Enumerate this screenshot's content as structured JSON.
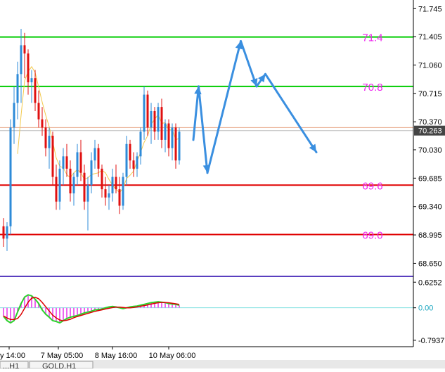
{
  "chart_data": {
    "type": "candlestick",
    "symbol_tabs": [
      "...H1",
      "GOLD,H1"
    ],
    "price_axis": {
      "ticks": [
        "71.745",
        "71.405",
        "71.060",
        "70.715",
        "70.370",
        "70.030",
        "69.685",
        "69.340",
        "68.995",
        "68.650"
      ],
      "ylim": [
        68.5,
        71.85
      ],
      "current_price": "70.263"
    },
    "time_axis": {
      "labels": [
        "y 14:00",
        "7 May 05:00",
        "8 May 16:00",
        "10 May 06:00"
      ]
    },
    "levels": [
      {
        "label": "71.4",
        "price": 71.4,
        "line_color": "#00cc00",
        "label_color": "#ee22ee"
      },
      {
        "label": "70.8",
        "price": 70.8,
        "line_color": "#00cc00",
        "label_color": "#ee22ee"
      },
      {
        "label": "69.6",
        "price": 69.6,
        "line_color": "#e00000",
        "label_color": "#ee22ee"
      },
      {
        "label": "69.0",
        "price": 69.0,
        "line_color": "#e00000",
        "label_color": "#ee22ee"
      }
    ],
    "bid_line": {
      "price": 70.3,
      "color": "#e8a888"
    },
    "ask_line": {
      "price": 70.263,
      "color": "#bbbbbb"
    },
    "candles": [
      [
        69.1,
        69.2,
        68.85,
        68.95
      ],
      [
        68.95,
        69.15,
        68.8,
        69.1
      ],
      [
        69.1,
        70.4,
        69.0,
        70.3
      ],
      [
        70.3,
        70.8,
        70.1,
        70.6
      ],
      [
        70.6,
        71.1,
        70.4,
        70.95
      ],
      [
        70.95,
        71.5,
        70.6,
        71.3
      ],
      [
        71.3,
        71.45,
        70.9,
        71.2
      ],
      [
        71.2,
        71.25,
        70.7,
        70.85
      ],
      [
        70.85,
        71.0,
        70.6,
        70.9
      ],
      [
        70.9,
        71.0,
        70.5,
        70.6
      ],
      [
        70.6,
        70.75,
        70.3,
        70.4
      ],
      [
        70.4,
        70.55,
        70.2,
        70.3
      ],
      [
        70.3,
        70.4,
        69.95,
        70.05
      ],
      [
        70.05,
        70.3,
        69.8,
        70.2
      ],
      [
        70.2,
        70.25,
        69.6,
        69.7
      ],
      [
        69.7,
        69.85,
        69.3,
        69.4
      ],
      [
        69.4,
        69.9,
        69.3,
        69.8
      ],
      [
        69.8,
        70.05,
        69.6,
        69.95
      ],
      [
        69.95,
        70.1,
        69.7,
        69.8
      ],
      [
        69.8,
        69.9,
        69.4,
        69.5
      ],
      [
        69.5,
        69.75,
        69.35,
        69.7
      ],
      [
        69.7,
        70.1,
        69.6,
        70.0
      ],
      [
        70.0,
        70.15,
        69.65,
        69.75
      ],
      [
        69.75,
        69.85,
        69.3,
        69.4
      ],
      [
        69.4,
        69.7,
        69.05,
        69.6
      ],
      [
        69.6,
        70.0,
        69.5,
        69.9
      ],
      [
        69.9,
        70.15,
        69.8,
        70.05
      ],
      [
        70.05,
        70.1,
        69.7,
        69.8
      ],
      [
        69.8,
        69.85,
        69.45,
        69.55
      ],
      [
        69.55,
        69.7,
        69.35,
        69.45
      ],
      [
        69.45,
        69.6,
        69.3,
        69.5
      ],
      [
        69.5,
        69.8,
        69.4,
        69.7
      ],
      [
        69.7,
        69.85,
        69.5,
        69.55
      ],
      [
        69.55,
        69.7,
        69.25,
        69.35
      ],
      [
        69.35,
        69.75,
        69.3,
        69.7
      ],
      [
        69.7,
        70.2,
        69.6,
        70.1
      ],
      [
        70.1,
        70.15,
        69.8,
        69.9
      ],
      [
        69.9,
        70.0,
        69.7,
        69.8
      ],
      [
        69.8,
        70.0,
        69.7,
        69.95
      ],
      [
        69.95,
        70.3,
        69.85,
        70.25
      ],
      [
        70.25,
        70.8,
        70.15,
        70.7
      ],
      [
        70.7,
        70.75,
        70.2,
        70.3
      ],
      [
        70.3,
        70.6,
        70.1,
        70.5
      ],
      [
        70.5,
        70.55,
        70.15,
        70.25
      ],
      [
        70.25,
        70.6,
        70.15,
        70.55
      ],
      [
        70.55,
        70.65,
        70.05,
        70.15
      ],
      [
        70.15,
        70.4,
        70.0,
        70.35
      ],
      [
        70.35,
        70.4,
        69.95,
        70.05
      ],
      [
        70.05,
        70.35,
        69.9,
        70.3
      ],
      [
        70.3,
        70.35,
        69.8,
        69.9
      ],
      [
        69.9,
        70.3,
        69.85,
        70.25
      ]
    ],
    "forecast_path": [
      {
        "bar": 54,
        "price": 70.15
      },
      {
        "bar": 55.5,
        "price": 70.8
      },
      {
        "bar": 58,
        "price": 69.75
      },
      {
        "bar": 67.5,
        "price": 71.35
      },
      {
        "bar": 72,
        "price": 70.8
      },
      {
        "bar": 74.5,
        "price": 70.95
      },
      {
        "bar": 89,
        "price": 70.0
      }
    ],
    "oscillator": {
      "ticks": [
        "0.6252",
        "0.00",
        "-0.7937"
      ],
      "ylim": [
        -0.95,
        0.75
      ],
      "histogram": [
        -0.2,
        -0.3,
        -0.35,
        -0.3,
        -0.1,
        0.1,
        0.25,
        0.3,
        0.28,
        0.2,
        0.1,
        -0.05,
        -0.15,
        -0.22,
        -0.3,
        -0.32,
        -0.35,
        -0.3,
        -0.25,
        -0.22,
        -0.2,
        -0.18,
        -0.15,
        -0.12,
        -0.1,
        -0.08,
        -0.05,
        -0.04,
        -0.03,
        0.0,
        0.02,
        0.03,
        0.02,
        0.0,
        -0.02,
        0.0,
        0.02,
        0.03,
        0.04,
        0.06,
        0.08,
        0.1,
        0.12,
        0.13,
        0.14,
        0.13,
        0.12,
        0.1,
        0.09,
        0.08,
        0.06
      ],
      "signal_line_color": "#dd0000",
      "main_line_color": "#2bd12b",
      "histogram_color": "#ee66ee"
    }
  }
}
